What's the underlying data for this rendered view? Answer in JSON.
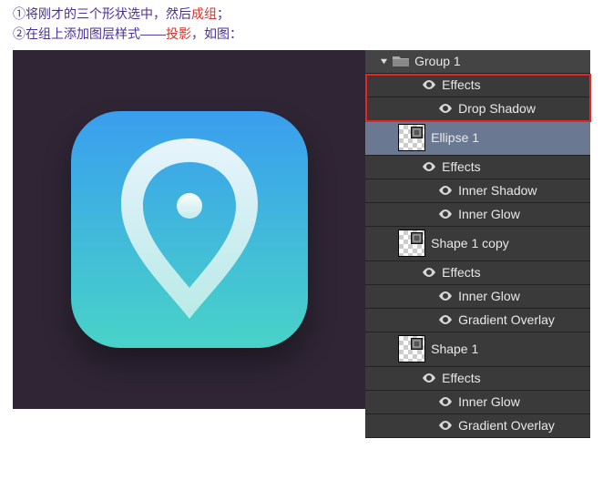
{
  "instructions": {
    "line1_pre": "①将刚才的三个形状选中，然后",
    "line1_red": "成组",
    "line1_post": "；",
    "line2_pre": "②在组上添加图层样式——",
    "line2_red": "投影",
    "line2_post": "，如图："
  },
  "layers": {
    "group1": "Group 1",
    "effects1": "Effects",
    "dropshadow": "Drop Shadow",
    "ellipse1": "Ellipse 1",
    "effects2": "Effects",
    "innershadow": "Inner Shadow",
    "innerglow1": "Inner Glow",
    "shape1copy": "Shape 1 copy",
    "effects3": "Effects",
    "innerglow2": "Inner Glow",
    "gradoverlay1": "Gradient Overlay",
    "shape1": "Shape 1",
    "effects4": "Effects",
    "innerglow3": "Inner Glow",
    "gradoverlay2": "Gradient Overlay"
  }
}
